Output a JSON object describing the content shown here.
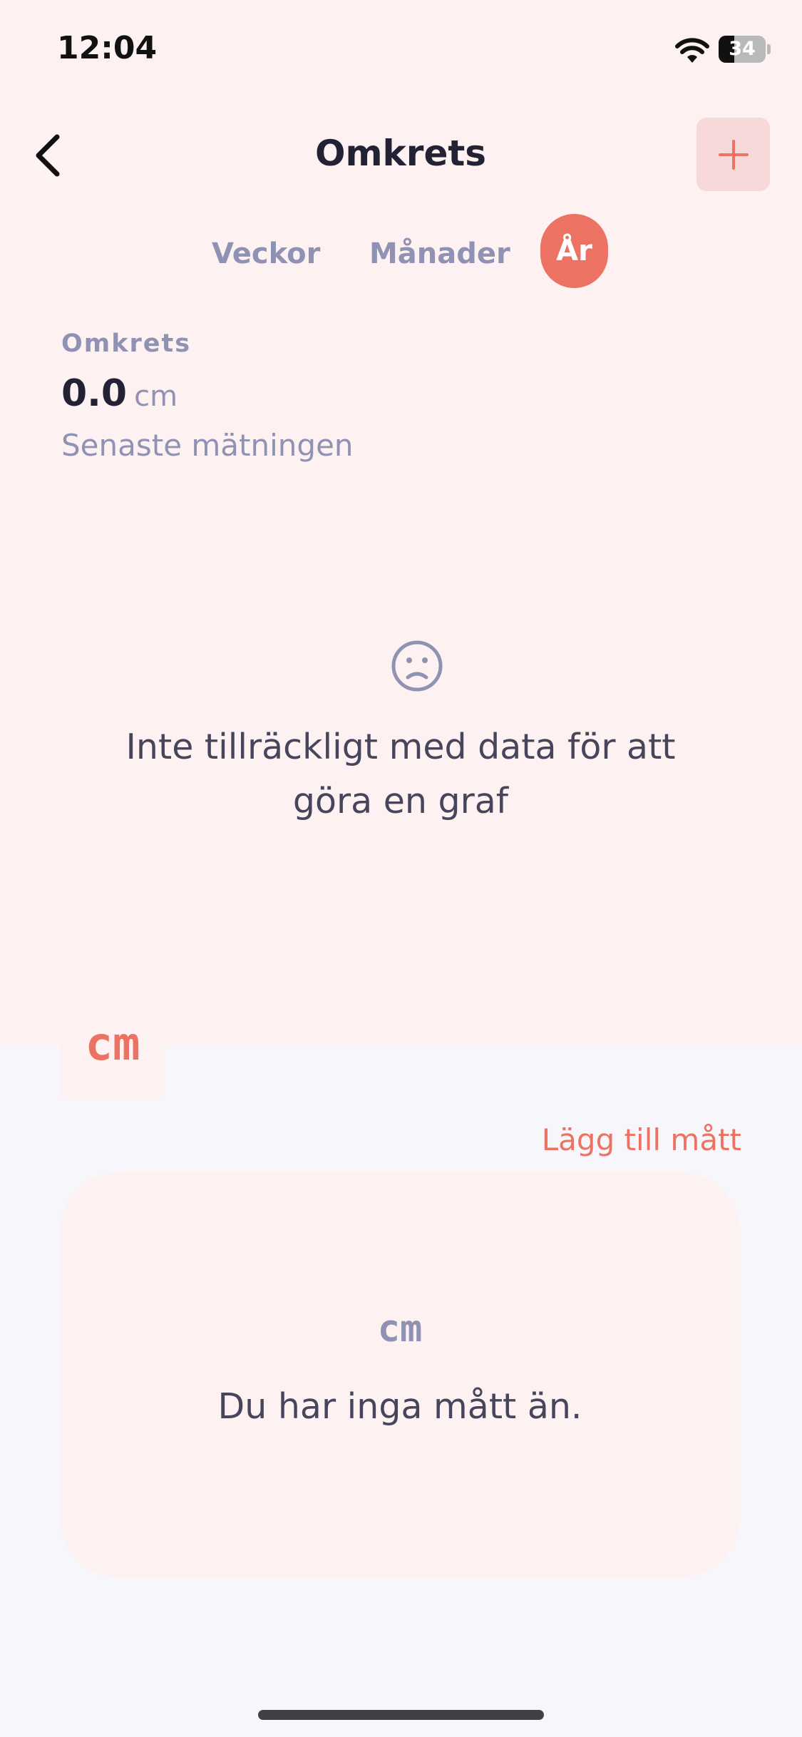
{
  "status_bar": {
    "time": "12:04",
    "battery_level": "34",
    "battery_fraction": 0.34
  },
  "header": {
    "back_icon": "chevron-left-icon",
    "title": "Omkrets",
    "add_icon": "plus-icon",
    "accent_color": "#ec7364"
  },
  "period_tabs": {
    "weeks": "Veckor",
    "months": "Månader",
    "year": "År",
    "selected": "year"
  },
  "summary": {
    "label": "Omkrets",
    "value": "0.0",
    "unit": "cm",
    "caption": "Senaste mätningen"
  },
  "chart_empty": {
    "icon": "sad-face-icon",
    "message": "Inte tillräckligt med data för att göra en graf"
  },
  "unit_badge": {
    "label": "cm"
  },
  "measurements": {
    "add_link": "Lägg till mått",
    "empty_icon": "cm",
    "empty_message": "Du har inga mått än."
  }
}
